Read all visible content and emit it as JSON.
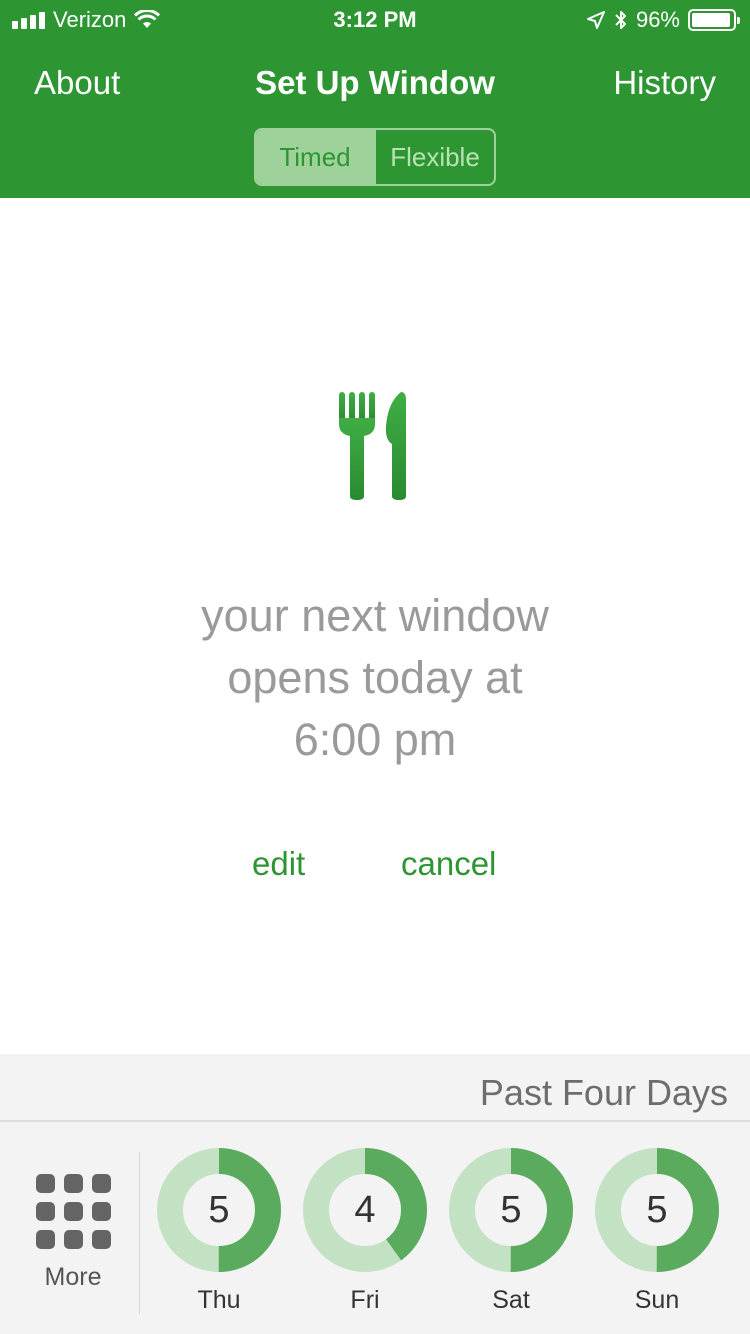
{
  "status_bar": {
    "carrier": "Verizon",
    "time": "3:12 PM",
    "battery": "96%",
    "battery_level": 0.96
  },
  "nav": {
    "left": "About",
    "title": "Set Up Window",
    "right": "History"
  },
  "segments": {
    "timed": "Timed",
    "flexible": "Flexible",
    "selected": "Timed"
  },
  "main": {
    "icon": "fork-knife-icon",
    "line1": "your next window",
    "line2": "opens today at",
    "line3": "6:00 pm",
    "edit": "edit",
    "cancel": "cancel"
  },
  "bottom": {
    "title": "Past Four Days",
    "more": "More",
    "days": [
      {
        "label": "Thu",
        "value": "5",
        "fraction": 0.5
      },
      {
        "label": "Fri",
        "value": "4",
        "fraction": 0.4
      },
      {
        "label": "Sat",
        "value": "5",
        "fraction": 0.5
      },
      {
        "label": "Sun",
        "value": "5",
        "fraction": 0.5
      }
    ]
  },
  "colors": {
    "brand_green": "#2d9633",
    "ring_light": "#c3e1c3",
    "ring_dark": "#5aab5e"
  }
}
